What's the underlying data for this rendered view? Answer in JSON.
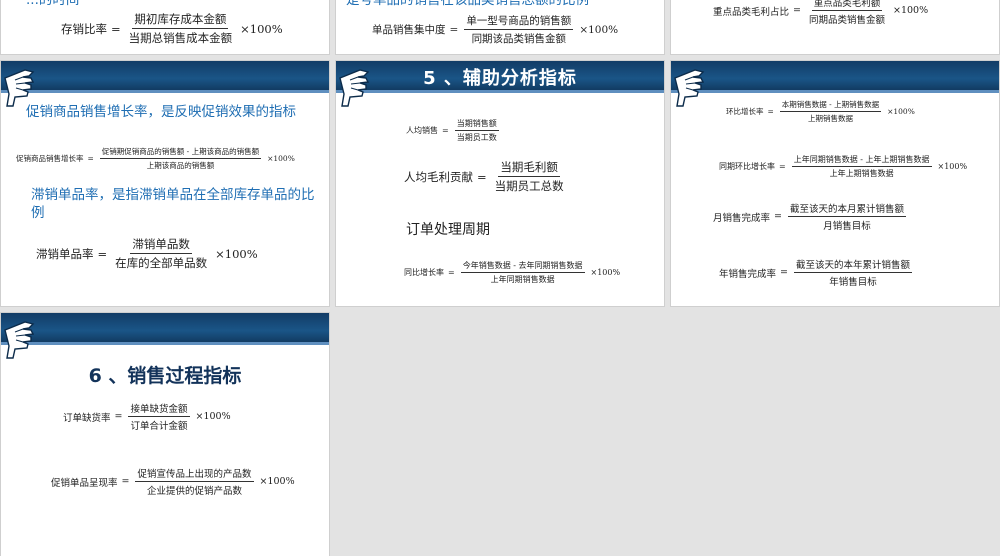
{
  "top_left": {
    "partial_text": "...的时间",
    "f1": {
      "label": "存销比率",
      "num": "期初库存成本金额",
      "den": "当期总销售成本金额",
      "pct": "×100%"
    }
  },
  "top_mid": {
    "partial_text": "是号单品的销售在该品类销售总额的比例",
    "f1": {
      "label": "单品销售集中度",
      "num": "单一型号商品的销售额",
      "den": "同期该品类销售金额",
      "pct": "×100%"
    }
  },
  "top_right": {
    "f1": {
      "label": "重点品类毛利占比",
      "num": "重点品类毛利额",
      "den": "同期品类销售金额",
      "pct": "×100%"
    }
  },
  "mid_left": {
    "text1": "促销商品销售增长率，是反映促销效果的指标",
    "f1": {
      "label": "促销商品销售增长率",
      "num": "促销期促销商品的销售额 - 上期该商品的销售额",
      "den": "上期该商品的销售额",
      "pct": "×100%"
    },
    "text2": "滞销单品率，是指滞销单品在全部库存单品的比例",
    "f2": {
      "label": "滞销单品率",
      "num": "滞销单品数",
      "den": "在库的全部单品数",
      "pct": "×100%"
    }
  },
  "mid_mid": {
    "title": "5 、辅助分析指标",
    "f1": {
      "label": "人均销售",
      "num": "当期销售额",
      "den": "当期员工数"
    },
    "f2": {
      "label": "人均毛利贡献",
      "num": "当期毛利额",
      "den": "当期员工总数"
    },
    "text1": "订单处理周期",
    "f3": {
      "label": "同比增长率",
      "num": "今年销售数据 - 去年同期销售数据",
      "den": "上年同期销售数据",
      "pct": "×100%"
    }
  },
  "mid_right": {
    "f1": {
      "label": "环比增长率",
      "num": "本期销售数据 - 上期销售数据",
      "den": "上期销售数据",
      "pct": "×100%"
    },
    "f2": {
      "label": "同期环比增长率",
      "num": "上年同期销售数据 - 上年上期销售数据",
      "den": "上年上期销售数据",
      "pct": "×100%"
    },
    "f3": {
      "label": "月销售完成率",
      "num": "截至该天的本月累计销售额",
      "den": "月销售目标"
    },
    "f4": {
      "label": "年销售完成率",
      "num": "截至该天的本年累计销售额",
      "den": "年销售目标"
    }
  },
  "bottom_left": {
    "title": "6 、销售过程指标",
    "f1": {
      "label": "订单缺货率",
      "num": "接单缺货金额",
      "den": "订单合计金额",
      "pct": "×100%"
    },
    "f2": {
      "label": "促销单品呈现率",
      "num": "促销宣传品上出现的产品数",
      "den": "企业提供的促销产品数",
      "pct": "×100%"
    }
  },
  "colors": {
    "banner": "#1a5587",
    "blue_text": "#1f6eb3",
    "title": "#13335a",
    "background": "#e3e3e3"
  }
}
